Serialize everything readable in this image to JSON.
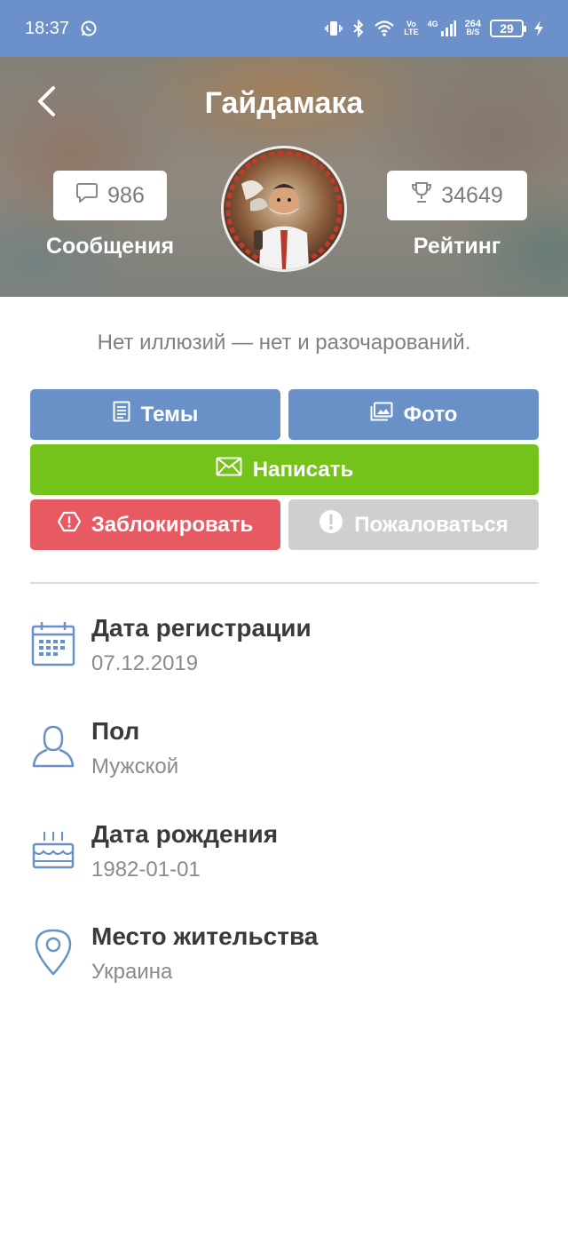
{
  "status_bar": {
    "time": "18:37",
    "left_icons": [
      "whatsapp-icon"
    ],
    "right_icons": [
      "vibrate-icon",
      "bluetooth-icon",
      "wifi-icon",
      "volte-icon",
      "signal-4g-icon"
    ],
    "volte_top": "Vo",
    "volte_bottom": "LTE",
    "net_type": "4G",
    "speed_value": "264",
    "speed_unit": "B/S",
    "battery": "29"
  },
  "header": {
    "back_icon": "chevron-left-icon",
    "title": "Гайдамака",
    "messages": {
      "icon": "chat-bubble-icon",
      "count": "986",
      "label": "Сообщения"
    },
    "rating": {
      "icon": "trophy-icon",
      "count": "34649",
      "label": "Рейтинг"
    },
    "avatar_icon": "user-avatar"
  },
  "profile": {
    "status": "Нет иллюзий — нет и разочарований."
  },
  "actions": {
    "topics": {
      "label": "Темы",
      "icon": "document-icon"
    },
    "photo": {
      "label": "Фото",
      "icon": "images-icon"
    },
    "write": {
      "label": "Написать",
      "icon": "envelope-icon"
    },
    "block": {
      "label": "Заблокировать",
      "icon": "block-hexagon-icon"
    },
    "report": {
      "label": "Пожаловаться",
      "icon": "exclamation-circle-icon"
    }
  },
  "colors": {
    "status_bar": "#6c90c9",
    "primary_button": "#6a90c8",
    "write_button": "#73c31a",
    "block_button": "#e85a62",
    "report_button": "#cfcfcf",
    "info_icon": "#6a90c8"
  },
  "info": [
    {
      "icon": "calendar-icon",
      "label": "Дата регистрации",
      "value": "07.12.2019"
    },
    {
      "icon": "user-icon",
      "label": "Пол",
      "value": "Мужской"
    },
    {
      "icon": "cake-icon",
      "label": "Дата рождения",
      "value": "1982-01-01"
    },
    {
      "icon": "location-pin-icon",
      "label": "Место жительства",
      "value": "Украина"
    }
  ]
}
